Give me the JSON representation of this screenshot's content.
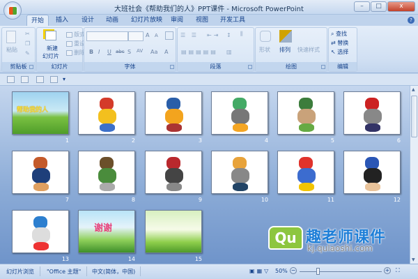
{
  "window": {
    "title": "大班社会《帮助我们的人》PPT课件 - Microsoft PowerPoint",
    "minimize": "–",
    "maximize": "□",
    "close": "x"
  },
  "tabs": [
    {
      "label": "开始",
      "active": true
    },
    {
      "label": "插入"
    },
    {
      "label": "设计"
    },
    {
      "label": "动画"
    },
    {
      "label": "幻灯片放映"
    },
    {
      "label": "审阅"
    },
    {
      "label": "视图"
    },
    {
      "label": "开发工具"
    }
  ],
  "ribbon": {
    "clipboard": {
      "label": "剪贴板",
      "paste": "粘贴"
    },
    "slides": {
      "label": "幻灯片",
      "new_slide": "新建",
      "new_slide2": "幻灯片",
      "layout": "版式",
      "reset": "重设",
      "delete": "删除"
    },
    "font": {
      "label": "字体",
      "grow": "A",
      "shrink": "A",
      "bold": "B",
      "italic": "I",
      "underline": "U",
      "strike": "abc",
      "shadow": "S",
      "spacing": "AV",
      "case": "Aa",
      "color": "A"
    },
    "paragraph": {
      "label": "段落"
    },
    "drawing": {
      "label": "绘图",
      "shapes": "形状",
      "arrange": "排列",
      "quick_styles": "快速样式"
    },
    "editing": {
      "label": "编辑",
      "find": "查找",
      "replace": "替换",
      "select": "选择"
    }
  },
  "slides": [
    {
      "number": "1",
      "kind": "title",
      "title": "帮助我的人"
    },
    {
      "number": "2"
    },
    {
      "number": "3"
    },
    {
      "number": "4"
    },
    {
      "number": "5"
    },
    {
      "number": "6"
    },
    {
      "number": "7"
    },
    {
      "number": "8"
    },
    {
      "number": "9"
    },
    {
      "number": "10"
    },
    {
      "number": "11"
    },
    {
      "number": "12"
    },
    {
      "number": "13"
    },
    {
      "number": "14",
      "kind": "thanks",
      "title": "谢谢"
    },
    {
      "number": "15",
      "kind": "scene"
    }
  ],
  "status": {
    "view": "幻灯片浏览",
    "theme": "\"Office 主题\"",
    "language": "中文(简体，中国)",
    "zoom": "50%",
    "zoom_percent": 50
  },
  "watermark": {
    "logo": "Qu",
    "name": "趣老师课件",
    "url": "kj.qulaoshi.com"
  }
}
